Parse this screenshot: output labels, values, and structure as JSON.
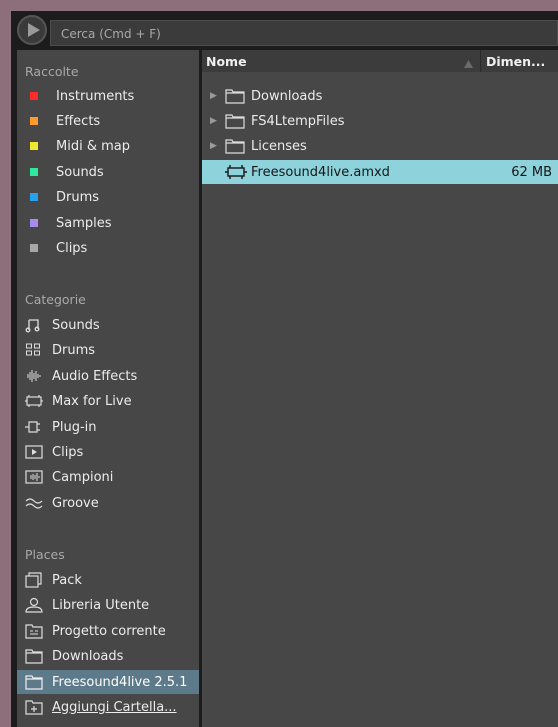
{
  "search": {
    "placeholder": "Cerca (Cmd + F)"
  },
  "sidebar": {
    "collections": {
      "header": "Raccolte",
      "items": [
        {
          "label": "Instruments",
          "color": "#ff2a2a"
        },
        {
          "label": "Effects",
          "color": "#ff9a2e"
        },
        {
          "label": "Midi & map",
          "color": "#f2e72e"
        },
        {
          "label": "Sounds",
          "color": "#2ee8a0"
        },
        {
          "label": "Drums",
          "color": "#28a0f0"
        },
        {
          "label": "Samples",
          "color": "#a98bf0"
        },
        {
          "label": "Clips",
          "color": "#a8a8a8"
        }
      ]
    },
    "categories": {
      "header": "Categorie",
      "items": [
        {
          "label": "Sounds",
          "icon": "note-icon"
        },
        {
          "label": "Drums",
          "icon": "drum-pads-icon"
        },
        {
          "label": "Audio Effects",
          "icon": "waveform-icon"
        },
        {
          "label": "Max for Live",
          "icon": "max-device-icon"
        },
        {
          "label": "Plug-in",
          "icon": "plug-icon"
        },
        {
          "label": "Clips",
          "icon": "clip-play-icon"
        },
        {
          "label": "Campioni",
          "icon": "sample-icon"
        },
        {
          "label": "Groove",
          "icon": "groove-icon"
        }
      ]
    },
    "places": {
      "header": "Places",
      "items": [
        {
          "label": "Pack",
          "icon": "pack-icon"
        },
        {
          "label": "Libreria Utente",
          "icon": "user-icon"
        },
        {
          "label": "Progetto corrente",
          "icon": "project-folder-icon"
        },
        {
          "label": "Downloads",
          "icon": "folder-icon"
        },
        {
          "label": "Freesound4live 2.5.1",
          "icon": "folder-icon",
          "selected": true
        },
        {
          "label": "Aggiungi Cartella...",
          "icon": "add-folder-icon"
        }
      ]
    }
  },
  "browser": {
    "columns": {
      "name": "Nome",
      "size": "Dimen..."
    },
    "rows": [
      {
        "name": "Downloads",
        "type": "folder",
        "size": ""
      },
      {
        "name": "FS4LtempFiles",
        "type": "folder",
        "size": ""
      },
      {
        "name": "Licenses",
        "type": "folder",
        "size": ""
      },
      {
        "name": "Freesound4live.amxd",
        "type": "device",
        "size": "62 MB",
        "selected": true
      }
    ]
  },
  "colors": {
    "selection_sidebar": "#5c7a8a",
    "selection_file": "#8ed3dc",
    "panel": "#474747"
  }
}
